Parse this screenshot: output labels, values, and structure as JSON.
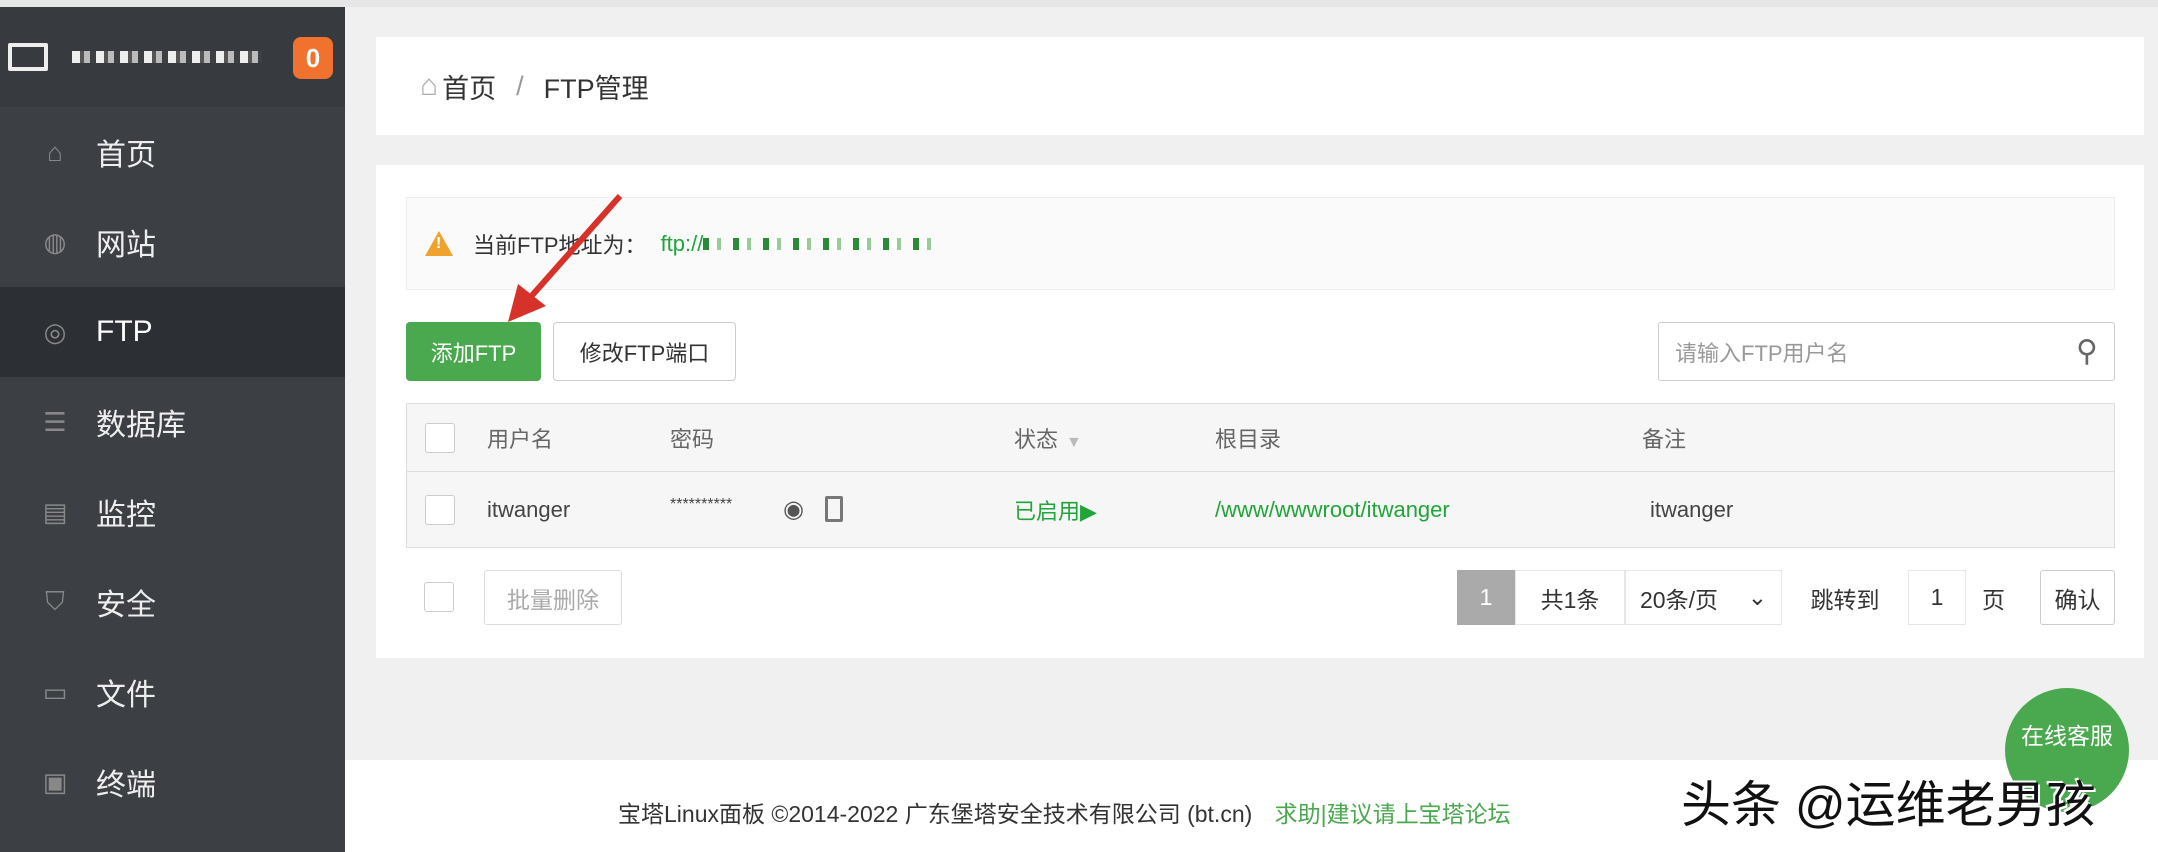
{
  "sidebar": {
    "badge": "0",
    "items": [
      {
        "label": "首页",
        "icon": "home-icon",
        "glyph": "⌂"
      },
      {
        "label": "网站",
        "icon": "globe-icon",
        "glyph": "◍"
      },
      {
        "label": "FTP",
        "icon": "ftp-icon",
        "glyph": "◎"
      },
      {
        "label": "数据库",
        "icon": "database-icon",
        "glyph": "☰"
      },
      {
        "label": "监控",
        "icon": "monitor-icon",
        "glyph": "▤"
      },
      {
        "label": "安全",
        "icon": "shield-icon",
        "glyph": "⛉"
      },
      {
        "label": "文件",
        "icon": "folder-icon",
        "glyph": "▭"
      },
      {
        "label": "终端",
        "icon": "terminal-icon",
        "glyph": "▣"
      }
    ],
    "active": "FTP"
  },
  "breadcrumb": {
    "home": "首页",
    "sep": "/",
    "current": "FTP管理"
  },
  "alert": {
    "label": "当前FTP地址为：",
    "value": "ftp://"
  },
  "toolbar": {
    "add": "添加FTP",
    "modify": "修改FTP端口",
    "search_placeholder": "请输入FTP用户名"
  },
  "table": {
    "headers": [
      "用户名",
      "密码",
      "状态",
      "根目录",
      "备注"
    ],
    "rows": [
      {
        "user": "itwanger",
        "password": "**********",
        "status": "已启用",
        "root": "/www/wwwroot/itwanger",
        "note": "itwanger"
      }
    ]
  },
  "bottom": {
    "batch_delete": "批量删除",
    "page": "1",
    "total": "共1条",
    "per_page": "20条/页",
    "jump": "跳转到",
    "jump_value": "1",
    "page_unit": "页",
    "confirm": "确认"
  },
  "footer": {
    "copyright": "宝塔Linux面板 ©2014-2022 广东堡塔安全技术有限公司 (bt.cn)",
    "link": "求助|建议请上宝塔论坛"
  },
  "chat": {
    "label": "在线客服"
  },
  "watermark": "头条 @运维老男孩",
  "colors": {
    "green": "#20a53a",
    "button_green": "#4aa84f",
    "sidebar": "#3c4045",
    "badge": "#f0722e"
  }
}
